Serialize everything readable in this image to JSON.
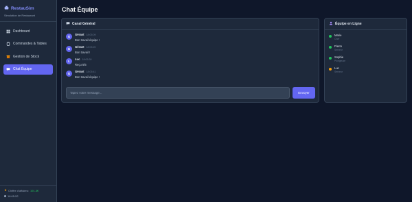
{
  "app": {
    "name": "RestauSim",
    "subtitle": "Simulation de Restaurant"
  },
  "sidebar": {
    "items": [
      {
        "label": "Dashboard",
        "icon": "dashboard-icon",
        "active": false
      },
      {
        "label": "Commandes & Tables",
        "icon": "clipboard-icon",
        "active": false
      },
      {
        "label": "Gestion de Stock",
        "icon": "box-icon",
        "active": false
      },
      {
        "label": "Chat Équipe",
        "icon": "chat-icon",
        "active": true
      }
    ],
    "footer": {
      "revenue_label": "Chiffre d'affaires:",
      "revenue_value": "191.3€",
      "time": "18:05:52"
    }
  },
  "page": {
    "title": "Chat Équipe"
  },
  "chat": {
    "channel_title": "Canal Général",
    "messages": [
      {
        "initial": "G",
        "author": "Gérant",
        "time": "18:05:09",
        "text": "Bon travail équipe !"
      },
      {
        "initial": "G",
        "author": "Gérant",
        "time": "18:05:20",
        "text": "Bon travail !"
      },
      {
        "initial": "L",
        "author": "Luc",
        "time": "18:05:30",
        "text": "Reçu 5/5"
      },
      {
        "initial": "G",
        "author": "Gérant",
        "time": "18:05:41",
        "text": "Bon travail équipe !"
      }
    ],
    "input_placeholder": "Tapez votre message...",
    "send_label": "Envoyer"
  },
  "team": {
    "title": "Équipe en Ligne",
    "members": [
      {
        "name": "Marie",
        "role": "Chef",
        "status": "online",
        "color": "#22c55e"
      },
      {
        "name": "Pierre",
        "role": "Serveur",
        "status": "online",
        "color": "#22c55e"
      },
      {
        "name": "Sophie",
        "role": "Plongeuse",
        "status": "online",
        "color": "#22c55e"
      },
      {
        "name": "Luc",
        "role": "Serveur",
        "status": "away",
        "color": "#f59e0b"
      }
    ]
  },
  "colors": {
    "accent": "#6366f1",
    "background": "#0f172a",
    "panel": "#1e293b",
    "online": "#22c55e",
    "away": "#f59e0b"
  }
}
